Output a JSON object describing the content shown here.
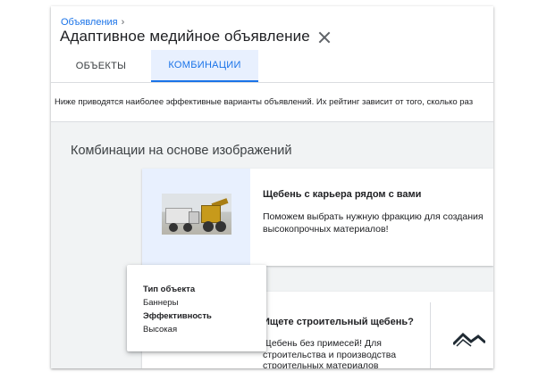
{
  "header": {
    "breadcrumb": "Объявления",
    "breadcrumb_chevron": "›",
    "title": "Адаптивное медийное объявление"
  },
  "tabs": [
    {
      "label": "ОБЪЕКТЫ",
      "selected": false
    },
    {
      "label": "КОМБИНАЦИИ",
      "selected": true
    }
  ],
  "notice": "Ниже приводятся наиболее эффективные варианты объявлений. Их рейтинг зависит от того, сколько раз",
  "section": {
    "title": "Комбинации на основе изображений"
  },
  "cards": [
    {
      "headline": "Щебень с карьера рядом с вами",
      "description": "Поможем выбрать нужную фракцию для создания высокопрочных материалов!"
    },
    {
      "headline": "Ищете строительный щебень?",
      "description_lines": [
        "Щебень без примесей! Для",
        "строительства и производства",
        "строительных материалов"
      ]
    }
  ],
  "tooltip": {
    "type_label": "Тип объекта",
    "type_value": "Баннеры",
    "perf_label": "Эффективность",
    "perf_value": "Высокая"
  },
  "colors": {
    "accent": "#1a73e8",
    "selected_tab_bg": "#e8f0fe",
    "content_bg": "#f1f3f4"
  },
  "icons": {
    "close": "close-icon",
    "breadcrumb_separator": "chevron-right-icon",
    "logo": "mountain-logo-icon"
  }
}
